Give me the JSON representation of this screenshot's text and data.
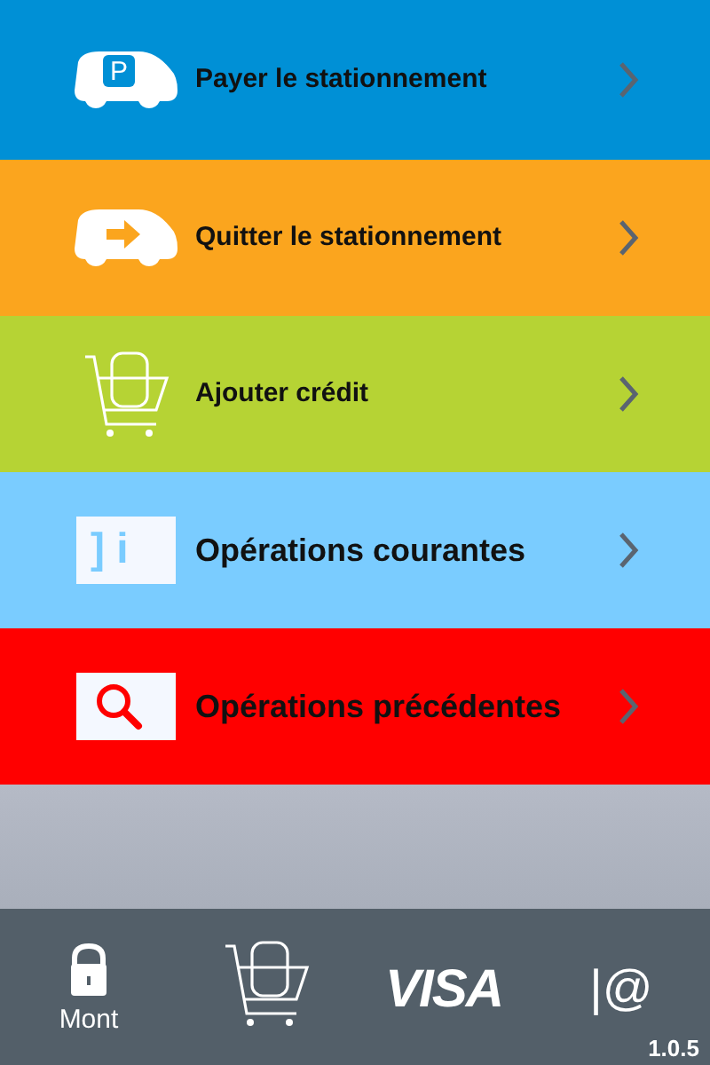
{
  "menu": [
    {
      "kind": "car-park",
      "label": "Payer le stationnement",
      "badge": "P",
      "color": "#0090d6"
    },
    {
      "kind": "car-exit",
      "label": "Quitter le stationnement",
      "color": "#fba51e"
    },
    {
      "kind": "cart",
      "label": "Ajouter crédit",
      "color": "#b6d334"
    },
    {
      "kind": "info",
      "label": "Opérations courantes",
      "badge": "] i",
      "color": "#7accff"
    },
    {
      "kind": "search",
      "label": "Opérations précédentes",
      "color": "#ff0000"
    }
  ],
  "footer": {
    "items": [
      {
        "kind": "lock",
        "label": "Mont"
      },
      {
        "kind": "cart"
      },
      {
        "kind": "visa",
        "text": "VISA"
      },
      {
        "kind": "at",
        "text": "|@"
      }
    ],
    "version": "1.0.5"
  }
}
